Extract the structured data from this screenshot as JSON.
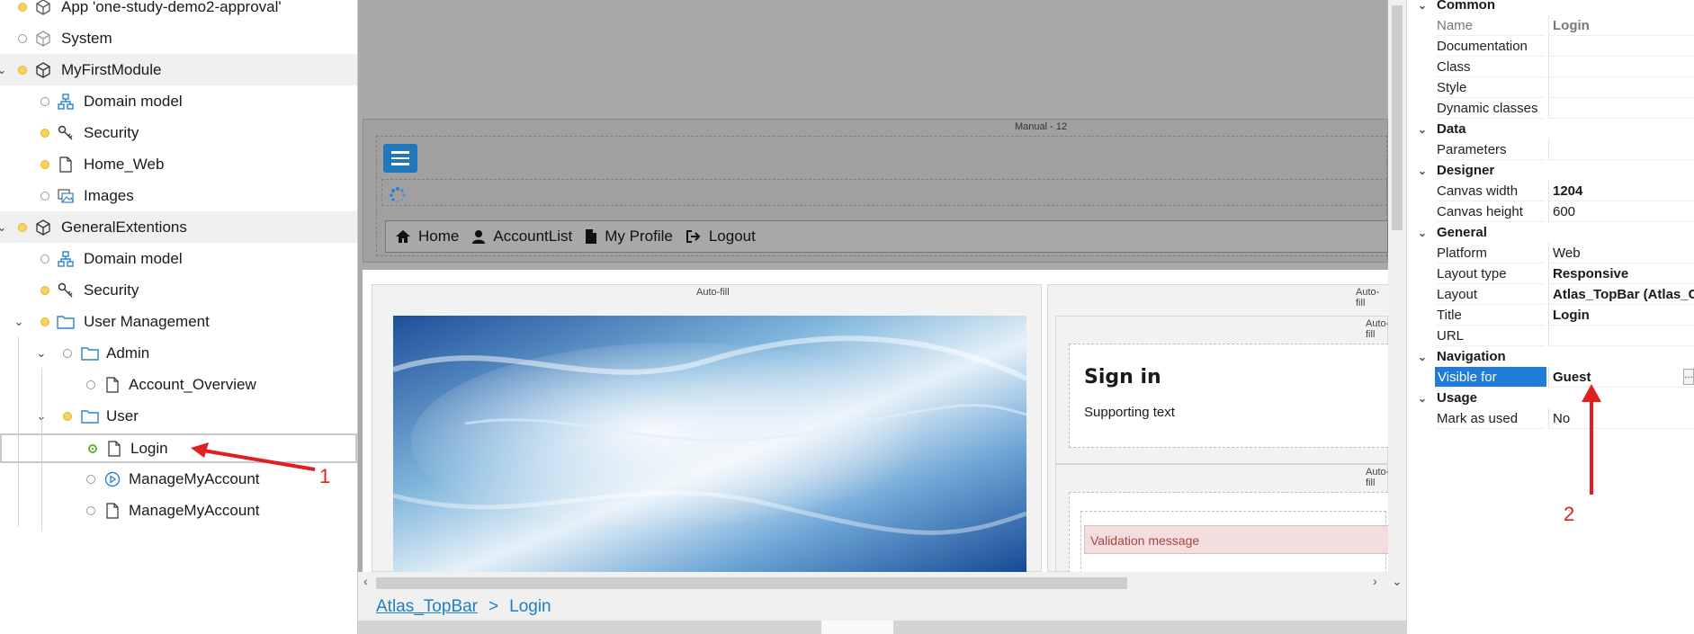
{
  "tree": {
    "items": [
      {
        "label": "App 'one-study-demo2-approval'"
      },
      {
        "label": "System"
      },
      {
        "label": "MyFirstModule"
      },
      {
        "label": "Domain model"
      },
      {
        "label": "Security"
      },
      {
        "label": "Home_Web"
      },
      {
        "label": "Images"
      },
      {
        "label": "GeneralExtentions"
      },
      {
        "label": "Domain model"
      },
      {
        "label": "Security"
      },
      {
        "label": "User Management"
      },
      {
        "label": "Admin"
      },
      {
        "label": "Account_Overview"
      },
      {
        "label": "User"
      },
      {
        "label": "Login"
      },
      {
        "label": "ManageMyAccount"
      },
      {
        "label": "ManageMyAccount"
      }
    ]
  },
  "canvas": {
    "layout_caption": "Manual - 12",
    "nav": [
      "Home",
      "AccountList",
      "My Profile",
      "Logout"
    ],
    "autofill_caption": "Auto-fill",
    "signin_title": "Sign in",
    "supporting_text": "Supporting text",
    "validation_message": "Validation message"
  },
  "breadcrumb": {
    "layout": "Atlas_TopBar",
    "separator": ">",
    "page": "Login"
  },
  "properties": {
    "categories": {
      "common": "Common",
      "data": "Data",
      "designer": "Designer",
      "general": "General",
      "navigation": "Navigation",
      "usage": "Usage"
    },
    "rows": {
      "name": {
        "label": "Name",
        "value": "Login"
      },
      "documentation": {
        "label": "Documentation",
        "value": ""
      },
      "class": {
        "label": "Class",
        "value": ""
      },
      "style": {
        "label": "Style",
        "value": ""
      },
      "dynamic_classes": {
        "label": "Dynamic classes",
        "value": ""
      },
      "parameters": {
        "label": "Parameters",
        "value": ""
      },
      "canvas_width": {
        "label": "Canvas width",
        "value": "1204"
      },
      "canvas_height": {
        "label": "Canvas height",
        "value": "600"
      },
      "platform": {
        "label": "Platform",
        "value": "Web"
      },
      "layout_type": {
        "label": "Layout type",
        "value": "Responsive"
      },
      "layout": {
        "label": "Layout",
        "value": "Atlas_TopBar (Atlas_Co"
      },
      "title": {
        "label": "Title",
        "value": "Login"
      },
      "url": {
        "label": "URL",
        "value": ""
      },
      "visible_for": {
        "label": "Visible for",
        "value": "Guest"
      },
      "mark_as_used": {
        "label": "Mark as used",
        "value": "No"
      }
    }
  },
  "annotations": {
    "one": "1",
    "two": "2"
  },
  "colors": {
    "accent": "#1f7bd6",
    "link": "#1f7fc5",
    "annotation": "#e02020",
    "hamburger": "#2077b9"
  }
}
